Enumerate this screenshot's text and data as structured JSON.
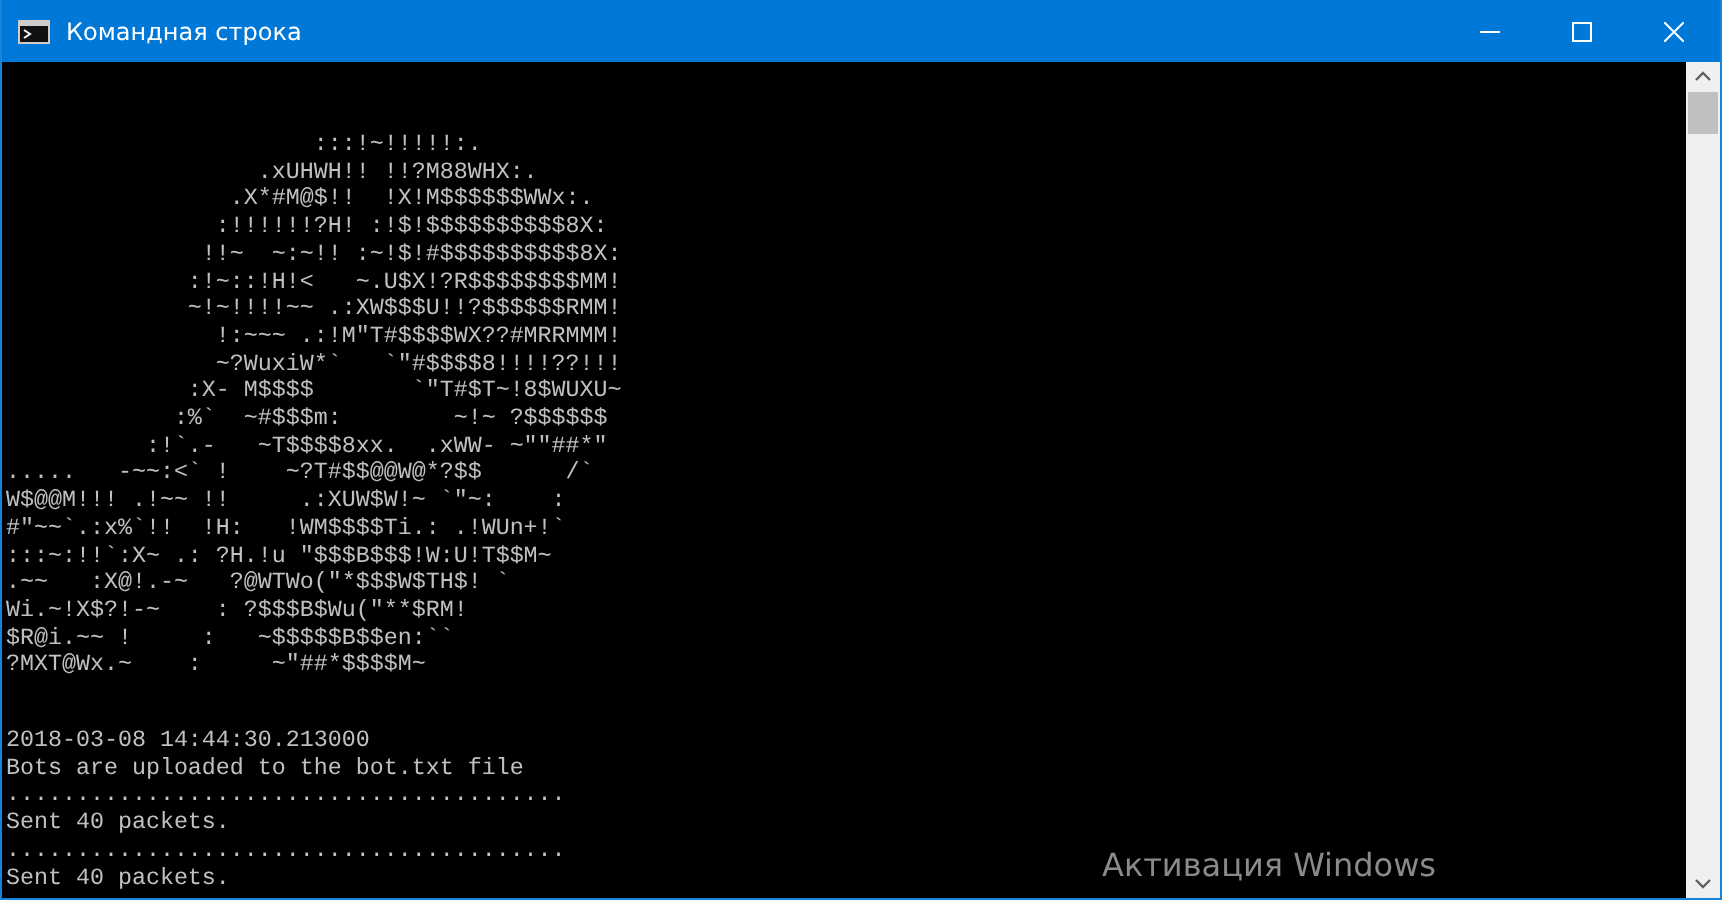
{
  "window": {
    "title": "Командная строка"
  },
  "console": {
    "art_lines": [
      "                      :::!~!!!!!:.",
      "                  .xUHWH!! !!?M88WHX:.",
      "                .X*#M@$!!  !X!M$$$$$$WWx:.",
      "               :!!!!!!?H! :!$!$$$$$$$$$$8X:",
      "              !!~  ~:~!! :~!$!#$$$$$$$$$$8X:",
      "             :!~::!H!<   ~.U$X!?R$$$$$$$$MM!",
      "             ~!~!!!!~~ .:XW$$$U!!?$$$$$$RMM!",
      "               !:~~~ .:!M\"T#$$$$WX??#MRRMMM!",
      "               ~?WuxiW*`   `\"#$$$$8!!!!??!!!",
      "             :X- M$$$$       `\"T#$T~!8$WUXU~",
      "            :%`  ~#$$$m:        ~!~ ?$$$$$$",
      "          :!`.-   ~T$$$$8xx.  .xWW- ~\"\"##*\"",
      ".....   -~~:<` !    ~?T#$$@@W@*?$$      /`",
      "W$@@M!!! .!~~ !!     .:XUW$W!~ `\"~:    :",
      "#\"~~`.:x%`!!  !H:   !WM$$$$Ti.: .!WUn+!`",
      ":::~:!!`:X~ .: ?H.!u \"$$$B$$$!W:U!T$$M~",
      ".~~   :X@!.-~   ?@WTWo(\"*$$$W$TH$! `",
      "Wi.~!X$?!-~    : ?$$$B$Wu(\"**$RM!",
      "$R@i.~~ !     :   ~$$$$$B$$en:``",
      "?MXT@Wx.~    :     ~\"##*$$$$M~"
    ],
    "output_lines": [
      "2018-03-08 14:44:30.213000",
      "Bots are uploaded to the bot.txt file",
      "........................................",
      "Sent 40 packets.",
      "........................................",
      "Sent 40 packets."
    ]
  },
  "activation_notice": "Активация Windows"
}
